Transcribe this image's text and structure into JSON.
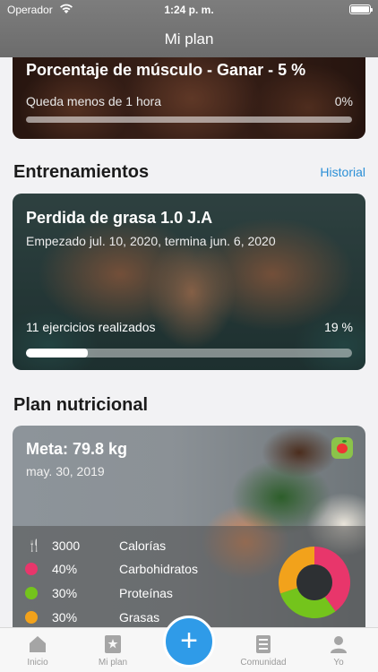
{
  "status_bar": {
    "carrier": "Operador",
    "time": "1:24 p. m."
  },
  "nav": {
    "title": "Mi plan"
  },
  "goal_card": {
    "title": "Porcentaje de músculo - Ganar - 5 %",
    "subtitle": "Queda menos de 1 hora",
    "percent_label": "0%",
    "progress": 0
  },
  "workouts": {
    "section_title": "Entrenamientos",
    "history_link": "Historial",
    "card": {
      "title": "Perdida de grasa 1.0 J.A",
      "dates": "Empezado jul. 10, 2020, termina jun. 6, 2020",
      "exercises_done": "11 ejercicios realizados",
      "percent_label": "19 %",
      "progress": 0.19
    }
  },
  "nutrition": {
    "section_title": "Plan nutricional",
    "goal": "Meta: 79.8 kg",
    "date": "may. 30, 2019",
    "macros": [
      {
        "value": "3000",
        "label": "Calorías",
        "color": "#41a7f5",
        "icon": "fork-knife-icon"
      },
      {
        "value": "40%",
        "label": "Carbohidratos",
        "color": "#e8366b"
      },
      {
        "value": "30%",
        "label": "Proteínas",
        "color": "#74c41c"
      },
      {
        "value": "30%",
        "label": "Grasas",
        "color": "#f2a21b"
      }
    ],
    "chart_values": [
      40,
      30,
      30
    ]
  },
  "tabs": [
    {
      "label": "Inicio",
      "icon": "home-icon"
    },
    {
      "label": "Mi plan",
      "icon": "plan-icon"
    },
    {
      "label": "",
      "icon": "plus-icon"
    },
    {
      "label": "Comunidad",
      "icon": "community-icon"
    },
    {
      "label": "Yo",
      "icon": "profile-icon"
    }
  ],
  "colors": {
    "accent": "#2f9be8",
    "link": "#2b8fd6"
  }
}
